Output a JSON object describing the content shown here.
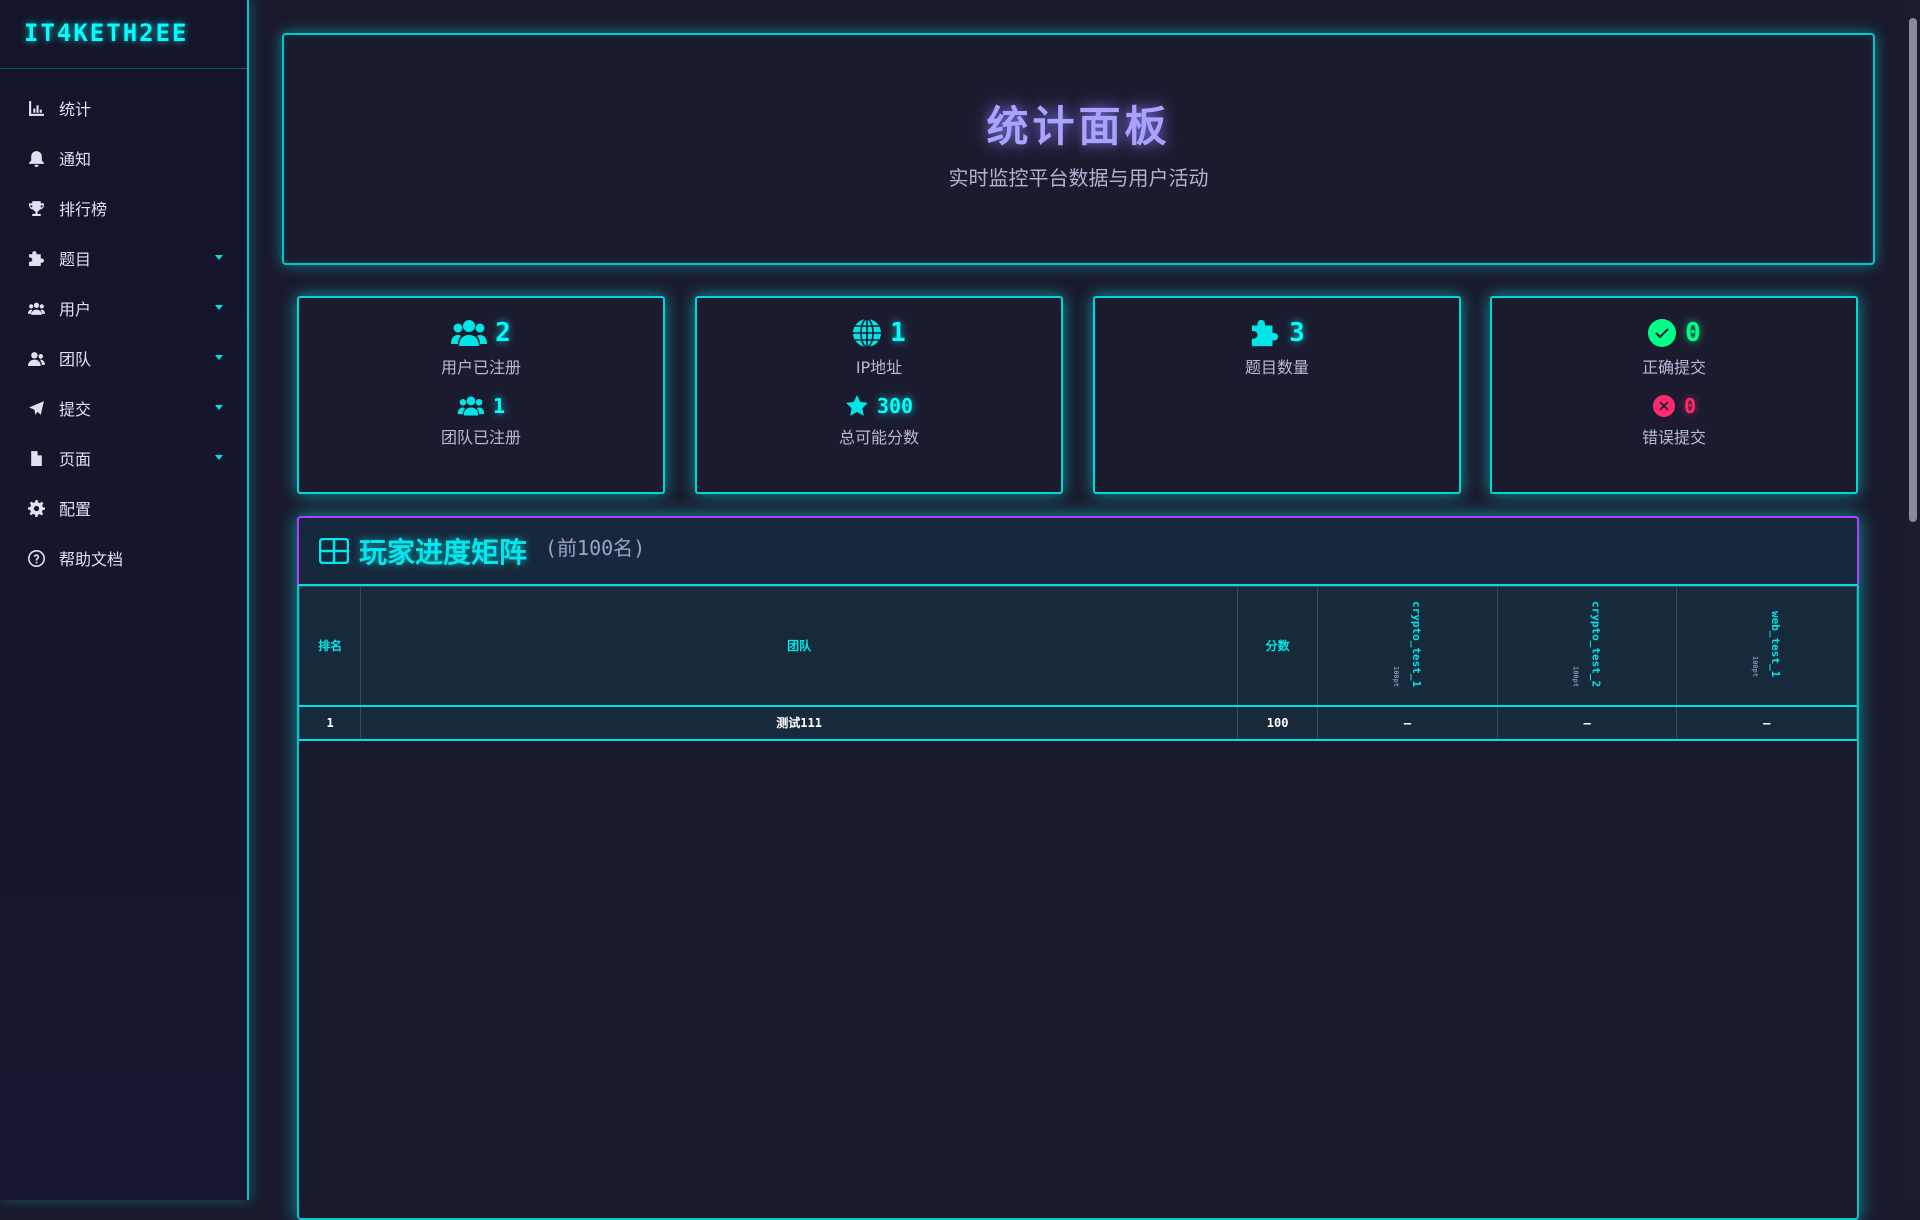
{
  "sidebar": {
    "brand": "IT4KETH2EE",
    "items": [
      {
        "label": "统计",
        "icon": "chart-icon",
        "has_caret": false
      },
      {
        "label": "通知",
        "icon": "bell-icon",
        "has_caret": false
      },
      {
        "label": "排行榜",
        "icon": "trophy-icon",
        "has_caret": false
      },
      {
        "label": "题目",
        "icon": "puzzle-icon",
        "has_caret": true
      },
      {
        "label": "用户",
        "icon": "users-icon",
        "has_caret": true
      },
      {
        "label": "团队",
        "icon": "team-icon",
        "has_caret": true
      },
      {
        "label": "提交",
        "icon": "paper-plane-icon",
        "has_caret": true
      },
      {
        "label": "页面",
        "icon": "file-icon",
        "has_caret": true
      },
      {
        "label": "配置",
        "icon": "gear-icon",
        "has_caret": false
      },
      {
        "label": "帮助文档",
        "icon": "help-circle-icon",
        "has_caret": false
      }
    ]
  },
  "hero": {
    "title": "统计面板",
    "subtitle": "实时监控平台数据与用户活动"
  },
  "cards": {
    "users": {
      "value": "2",
      "label": "用户已注册",
      "teams_value": "1",
      "teams_label": "团队已注册"
    },
    "ip": {
      "value": "1",
      "label": "IP地址",
      "points_value": "300",
      "points_label": "总可能分数"
    },
    "challenges": {
      "value": "3",
      "label": "题目数量"
    },
    "submissions": {
      "correct_value": "0",
      "correct_label": "正确提交",
      "wrong_value": "0",
      "wrong_label": "错误提交"
    }
  },
  "matrix": {
    "title": "玩家进度矩阵",
    "note": "(前100名)",
    "headers": {
      "rank": "排名",
      "team": "团队",
      "score": "分数"
    },
    "challenges": [
      {
        "name": "crypto_test_1",
        "points": "100pt"
      },
      {
        "name": "crypto_test_2",
        "points": "100pt"
      },
      {
        "name": "web_test_1",
        "points": "100pt"
      }
    ],
    "rows": [
      {
        "rank": "1",
        "team": "测试111",
        "score": "100",
        "cells": [
          "—",
          "—",
          "—"
        ]
      }
    ]
  },
  "colors": {
    "accent_cyan": "#00ffff",
    "accent_purple": "#a9a3ff",
    "success": "#00ff88",
    "danger": "#ff2a6d",
    "background": "#1a1a2e"
  }
}
